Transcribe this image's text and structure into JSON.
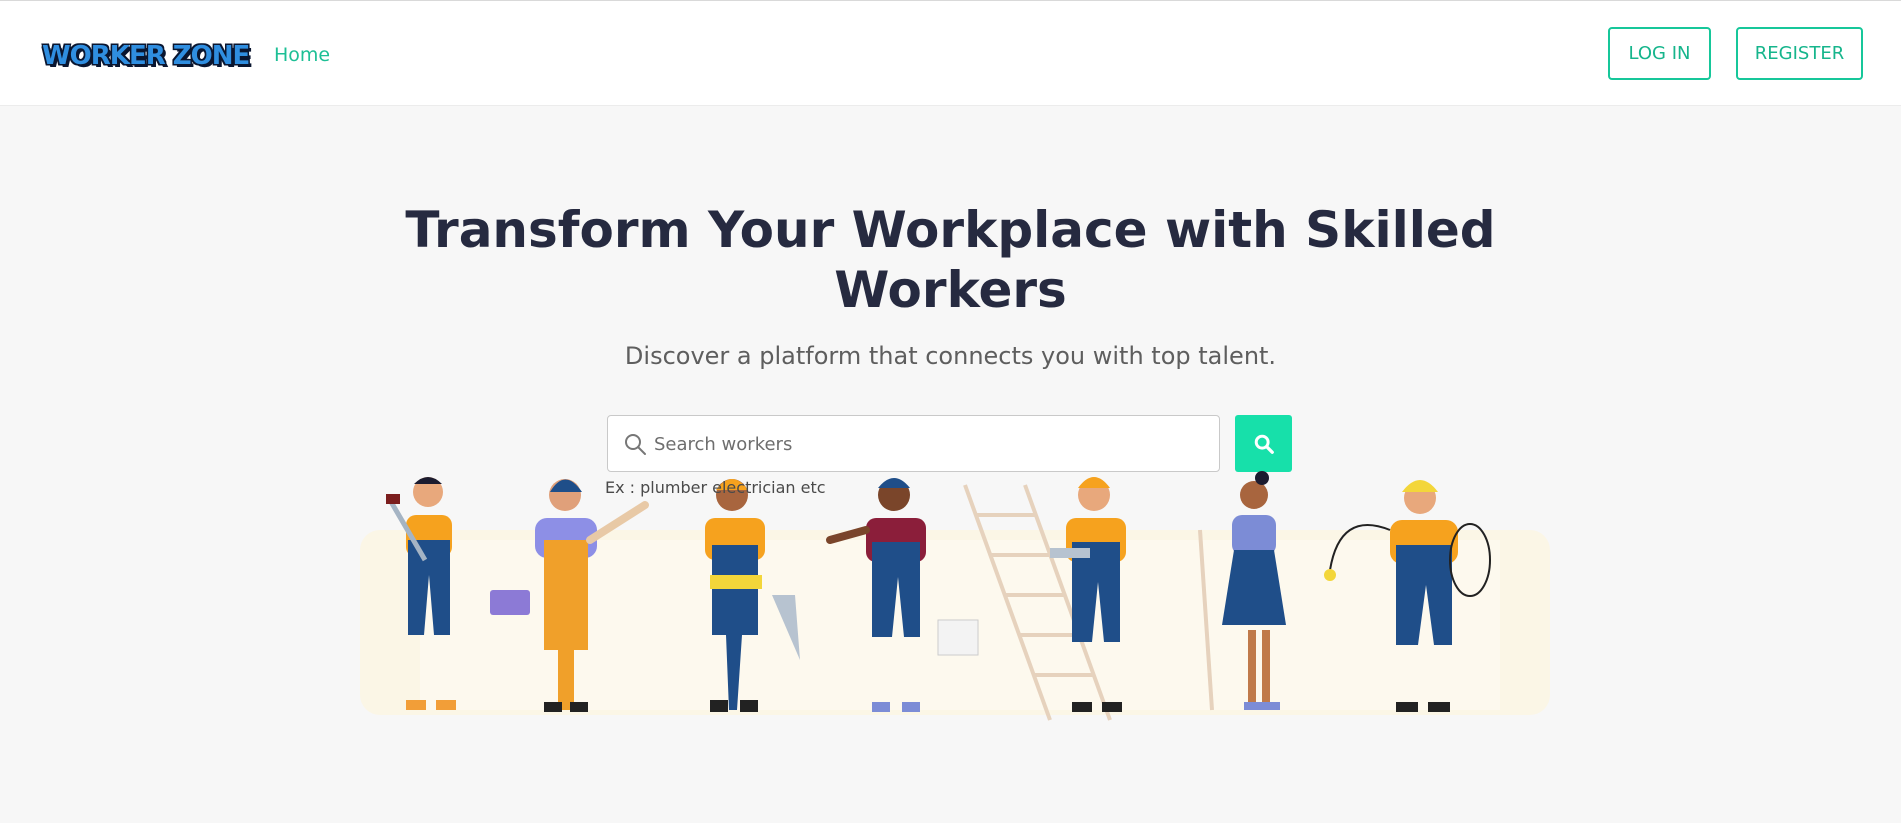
{
  "header": {
    "logo_text": "WORKER ZONE",
    "nav": [
      {
        "label": "Home"
      }
    ],
    "login_label": "LOG IN",
    "register_label": "REGISTER"
  },
  "hero": {
    "title_line1": "Transform Your Workplace with Skilled",
    "title_line2": "Workers",
    "subtitle": "Discover a platform that connects you with top talent."
  },
  "search": {
    "placeholder": "Search workers",
    "value": "",
    "hint": "Ex : plumber electrician etc",
    "button_icon": "search-icon"
  },
  "colors": {
    "accent": "#16c79a",
    "accent_fill": "#17e0aa",
    "title": "#262a40",
    "background": "#f7f7f7"
  },
  "illustration": {
    "icon": "workers-group-illustration"
  }
}
